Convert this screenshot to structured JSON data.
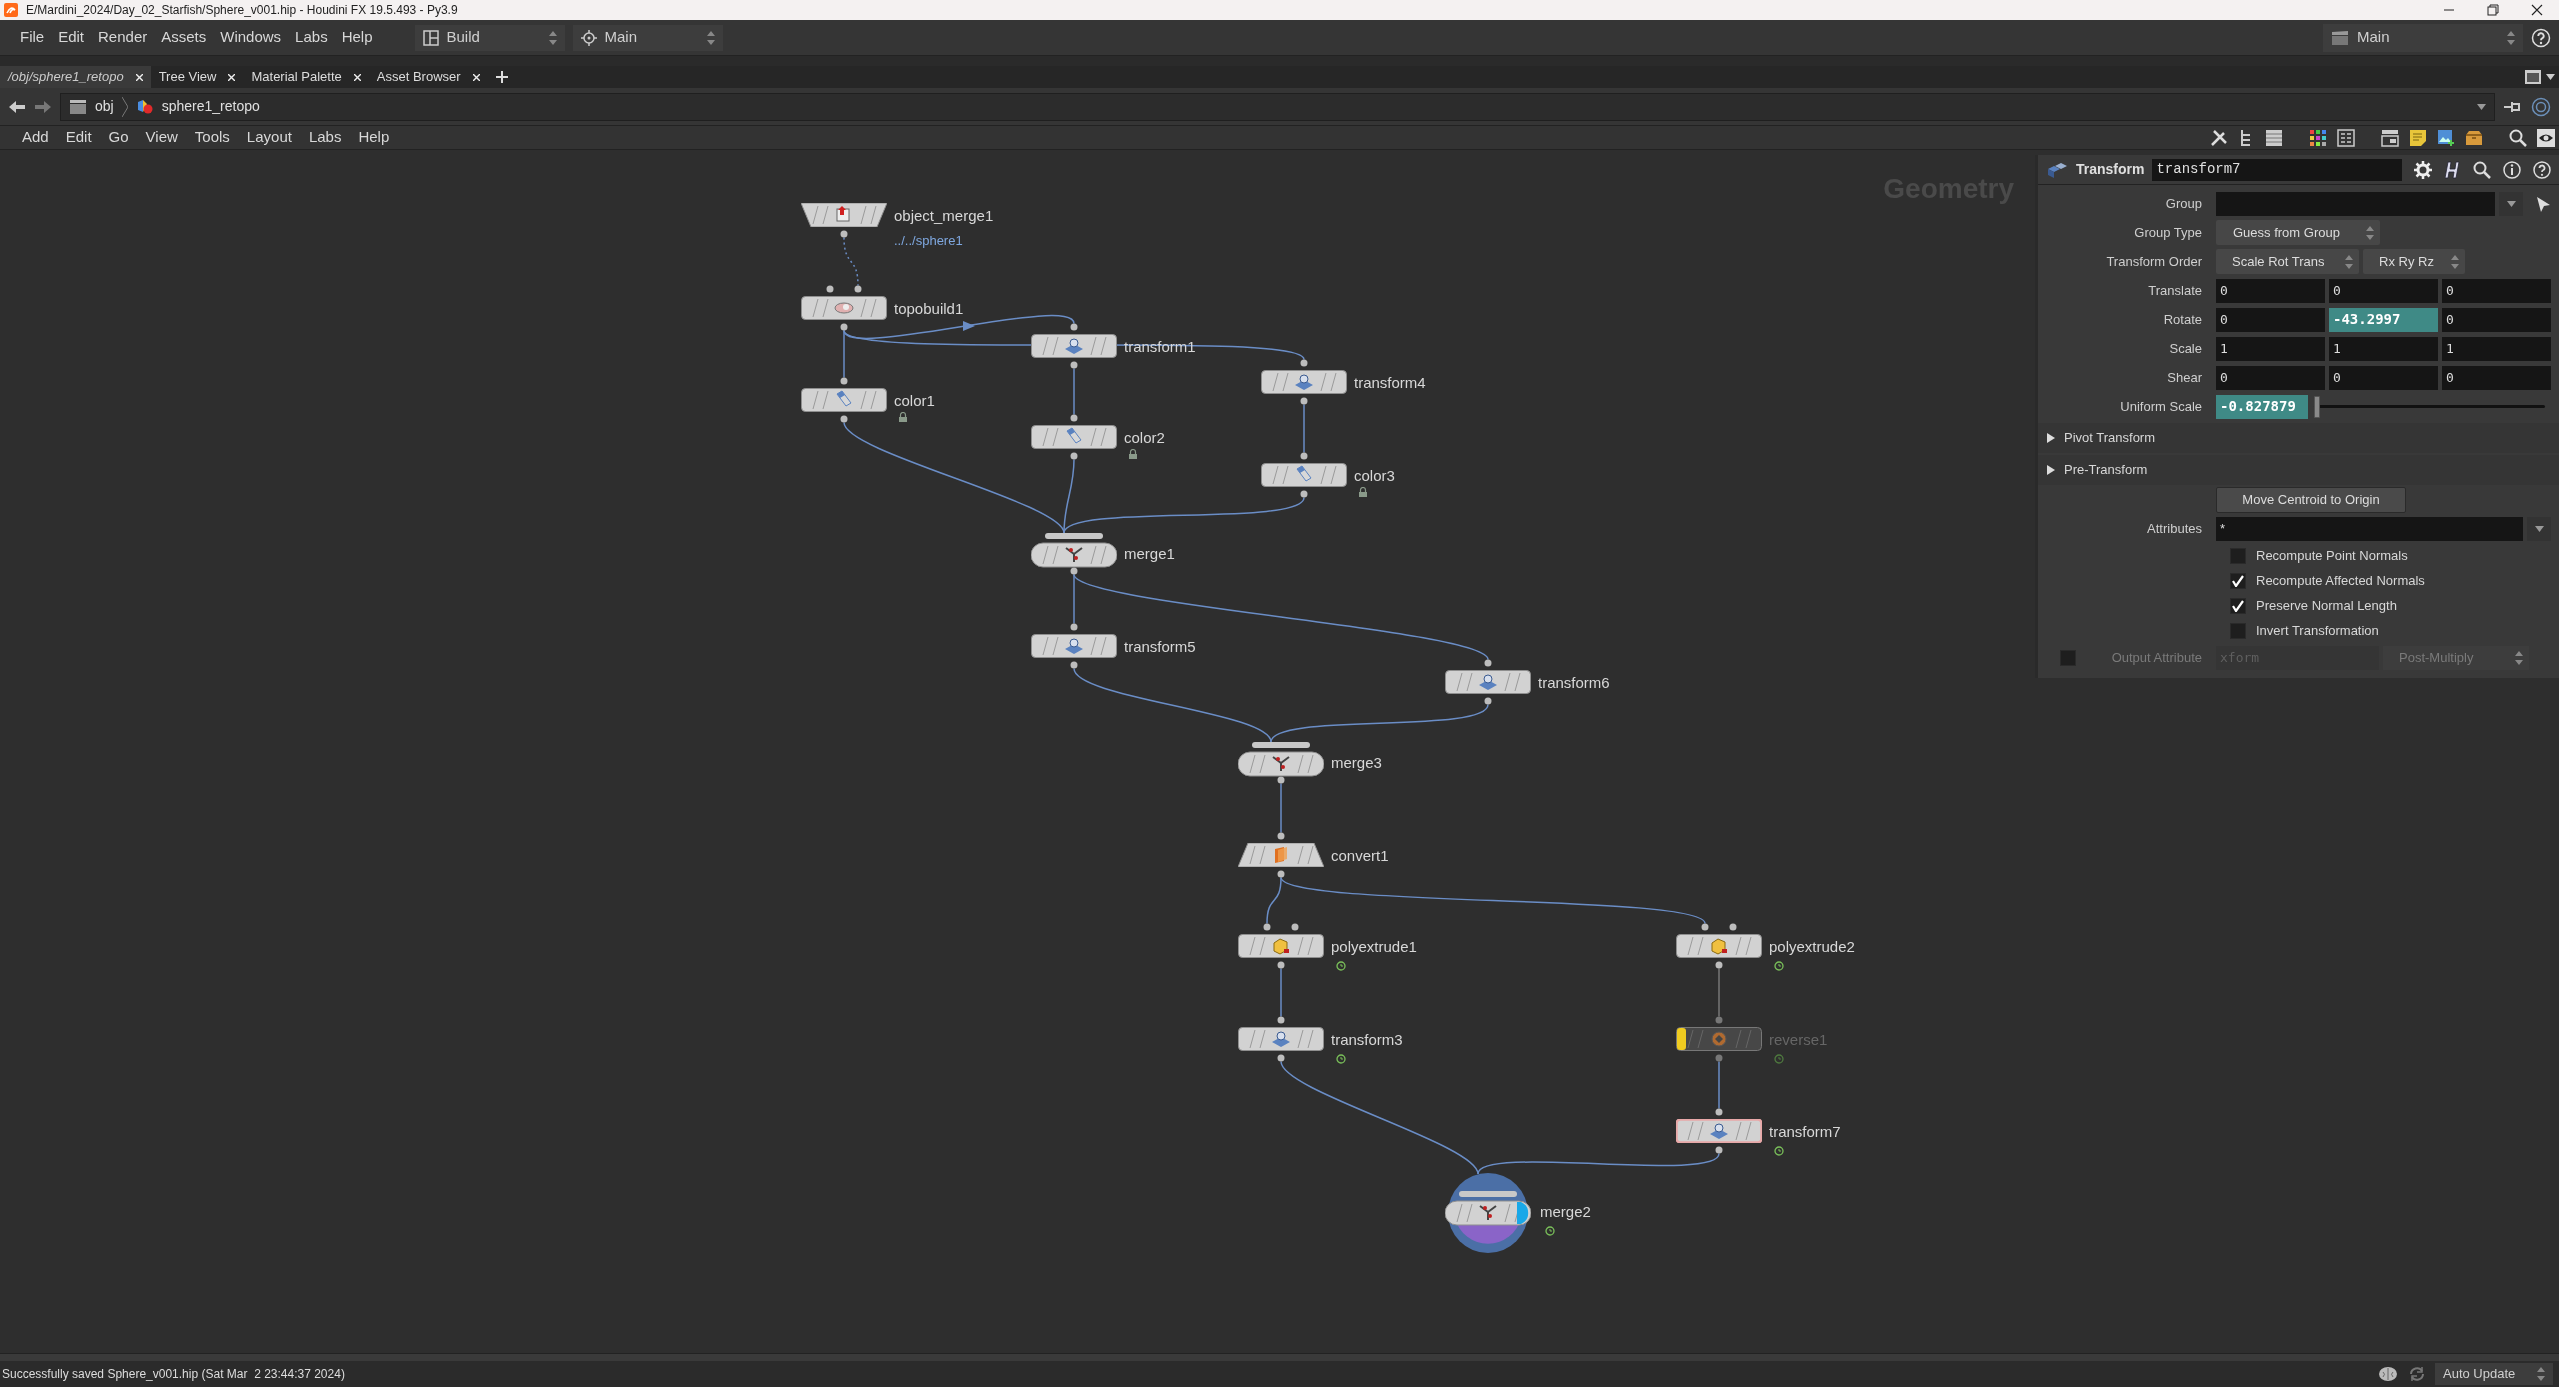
{
  "title_bar": {
    "title": "E/Mardini_2024/Day_02_Starfish/Sphere_v001.hip - Houdini FX 19.5.493 - Py3.9"
  },
  "main_menu": [
    "File",
    "Edit",
    "Render",
    "Assets",
    "Windows",
    "Labs",
    "Help"
  ],
  "desktop": "Build",
  "viewer_layout": "Main",
  "shelf_set": "Main",
  "pane_tabs": [
    {
      "label": "/obj/sphere1_retopo",
      "selected": true
    },
    {
      "label": "Tree View",
      "selected": false
    },
    {
      "label": "Material Palette",
      "selected": false
    },
    {
      "label": "Asset Browser",
      "selected": false
    }
  ],
  "path": [
    "obj",
    "sphere1_retopo"
  ],
  "network_menu": [
    "Add",
    "Edit",
    "Go",
    "View",
    "Tools",
    "Layout",
    "Labs",
    "Help"
  ],
  "network": {
    "context_label": "Geometry",
    "nodes": [
      {
        "name": "object_merge1",
        "kind": "object_merge",
        "comment": "../../sphere1",
        "bypassed": false,
        "selected": false,
        "display": false
      },
      {
        "name": "topobuild1",
        "kind": "topobuild",
        "bypassed": false,
        "selected": false,
        "display": false
      },
      {
        "name": "transform1",
        "kind": "transform",
        "bypassed": false,
        "selected": false,
        "display": false
      },
      {
        "name": "transform4",
        "kind": "transform",
        "bypassed": false,
        "selected": false,
        "display": false
      },
      {
        "name": "color1",
        "kind": "color",
        "locked": true,
        "bypassed": false,
        "selected": false,
        "display": false
      },
      {
        "name": "color2",
        "kind": "color",
        "locked": true,
        "bypassed": false,
        "selected": false,
        "display": false
      },
      {
        "name": "color3",
        "kind": "color",
        "locked": true,
        "bypassed": false,
        "selected": false,
        "display": false
      },
      {
        "name": "merge1",
        "kind": "merge",
        "bypassed": false,
        "selected": false,
        "display": false
      },
      {
        "name": "transform5",
        "kind": "transform",
        "bypassed": false,
        "selected": false,
        "display": false
      },
      {
        "name": "transform6",
        "kind": "transform",
        "bypassed": false,
        "selected": false,
        "display": false
      },
      {
        "name": "merge3",
        "kind": "merge",
        "bypassed": false,
        "selected": false,
        "display": false
      },
      {
        "name": "convert1",
        "kind": "convert",
        "bypassed": false,
        "selected": false,
        "display": false
      },
      {
        "name": "polyextrude1",
        "kind": "polyextrude",
        "time_dependent": true,
        "bypassed": false,
        "selected": false,
        "display": false
      },
      {
        "name": "polyextrude2",
        "kind": "polyextrude",
        "time_dependent": true,
        "bypassed": false,
        "selected": false,
        "display": false
      },
      {
        "name": "transform3",
        "kind": "transform",
        "time_dependent": true,
        "bypassed": false,
        "selected": false,
        "display": false
      },
      {
        "name": "reverse1",
        "kind": "reverse",
        "time_dependent": true,
        "bypassed": true,
        "selected": false,
        "display": false
      },
      {
        "name": "transform7",
        "kind": "transform",
        "time_dependent": true,
        "bypassed": false,
        "selected": true,
        "display": false
      },
      {
        "name": "merge2",
        "kind": "merge",
        "time_dependent": true,
        "bypassed": false,
        "selected": false,
        "display": true
      }
    ]
  },
  "parameters": {
    "node_type": "Transform",
    "node_name": "transform7",
    "rows": [
      {
        "kind": "string",
        "label": "Group",
        "dropdown": true
      },
      {
        "kind": "menu",
        "label": "Group Type",
        "values": [
          "Guess from Group"
        ]
      },
      {
        "kind": "menu",
        "label": "Transform Order",
        "values": [
          "Scale Rot Trans",
          "Rx Ry Rz"
        ]
      },
      {
        "kind": "vector",
        "label": "Translate",
        "values": [
          {
            "value": "0",
            "animated": false
          },
          {
            "value": "0",
            "animated": false
          },
          {
            "value": "0",
            "animated": false
          }
        ]
      },
      {
        "kind": "vector",
        "label": "Rotate",
        "values": [
          {
            "value": "0",
            "animated": false
          },
          {
            "value": "-43.2997",
            "animated": true
          },
          {
            "value": "0",
            "animated": false
          }
        ]
      },
      {
        "kind": "vector",
        "label": "Scale",
        "values": [
          {
            "value": "1",
            "animated": false
          },
          {
            "value": "1",
            "animated": false
          },
          {
            "value": "1",
            "animated": false
          }
        ]
      },
      {
        "kind": "vector",
        "label": "Shear",
        "values": [
          {
            "value": "0",
            "animated": false
          },
          {
            "value": "0",
            "animated": false
          },
          {
            "value": "0",
            "animated": false
          }
        ]
      },
      {
        "kind": "slider",
        "label": "Uniform Scale",
        "value": "-0.827879",
        "animated": true,
        "level": 0
      },
      {
        "kind": "folder",
        "label": "Pivot Transform",
        "expanded": false
      },
      {
        "kind": "folder",
        "label": "Pre-Transform",
        "expanded": false
      },
      {
        "kind": "button",
        "label": "Move Centroid to Origin"
      },
      {
        "kind": "string",
        "label": "Attributes",
        "value": "*",
        "dropdown": true
      },
      {
        "kind": "toggle",
        "label": "Recompute Point Normals",
        "checked": false
      },
      {
        "kind": "toggle",
        "label": "Recompute Affected Normals",
        "checked": true
      },
      {
        "kind": "toggle",
        "label": "Preserve Normal Length",
        "checked": true
      },
      {
        "kind": "toggle",
        "label": "Invert Transformation",
        "checked": false
      },
      {
        "kind": "output",
        "label": "Output Attribute",
        "checked": false,
        "value": "xform",
        "mode": "Post-Multiply",
        "disabled": true
      }
    ]
  },
  "status_bar": {
    "message": "Successfully saved Sphere_v001.hip (Sat Mar  2 23:44:37 2024)",
    "update_mode": "Auto Update"
  }
}
